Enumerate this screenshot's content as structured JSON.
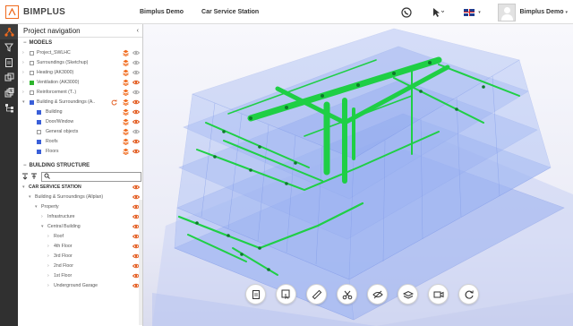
{
  "header": {
    "app_name": "BIMPLUS",
    "project": "Bimplus Demo",
    "model": "Car Service Station",
    "user_name": "Bimplus Demo",
    "language_flag": "uk-flag-icon",
    "accent_color": "#f06a1d"
  },
  "left_toolbar": {
    "icons": [
      "project-navigation-icon",
      "filter-icon",
      "clipboard-icon",
      "layers-copy-icon",
      "stacked-pages-icon",
      "hierarchy-icon"
    ]
  },
  "panel": {
    "title": "Project navigation",
    "models_heading": "MODELS",
    "models": [
      {
        "label": "Project_SWLHC",
        "color": null,
        "checked": false,
        "expandable": true
      },
      {
        "label": "Surroundings (Sketchup)",
        "color": null,
        "checked": false,
        "expandable": true
      },
      {
        "label": "Heating (AK3000)",
        "color": null,
        "checked": false,
        "expandable": true
      },
      {
        "label": "Ventilation (AK3000)",
        "color": "#2db52d",
        "checked": true,
        "expandable": true
      },
      {
        "label": "Reinforcement (T..)",
        "color": null,
        "checked": false,
        "expandable": true
      },
      {
        "label": "Building & Surroundings (A..",
        "color": "#3a5fd8",
        "checked": true,
        "expandable": true,
        "expanded": true
      }
    ],
    "model_children": [
      {
        "label": "Building",
        "color": "#3a5fd8"
      },
      {
        "label": "Door/Window",
        "color": "#3a5fd8"
      },
      {
        "label": "General objects",
        "color": null
      },
      {
        "label": "Roofs",
        "color": "#3a5fd8"
      },
      {
        "label": "Floors",
        "color": "#3a5fd8"
      }
    ],
    "structure_heading": "BUILDING STRUCTURE",
    "search_placeholder": "",
    "structure": [
      {
        "label": "CAR SERVICE STATION",
        "level": 0
      },
      {
        "label": "Building & Surroundings (Allplan)",
        "level": 1
      },
      {
        "label": "Property",
        "level": 2
      },
      {
        "label": "Infrastructure",
        "level": 3
      },
      {
        "label": "Central Building",
        "level": 3
      },
      {
        "label": "Roof",
        "level": 4
      },
      {
        "label": "4th Floor",
        "level": 4
      },
      {
        "label": "3rd Floor",
        "level": 4
      },
      {
        "label": "2nd Floor",
        "level": 4
      },
      {
        "label": "1st Floor",
        "level": 4
      },
      {
        "label": "Underground Garage",
        "level": 4
      }
    ]
  },
  "viewer_tools": [
    "clipboard-icon",
    "select-box-icon",
    "ruler-icon",
    "cut-icon",
    "hide-icon",
    "layers-icon",
    "camera-icon",
    "reset-view-icon"
  ]
}
